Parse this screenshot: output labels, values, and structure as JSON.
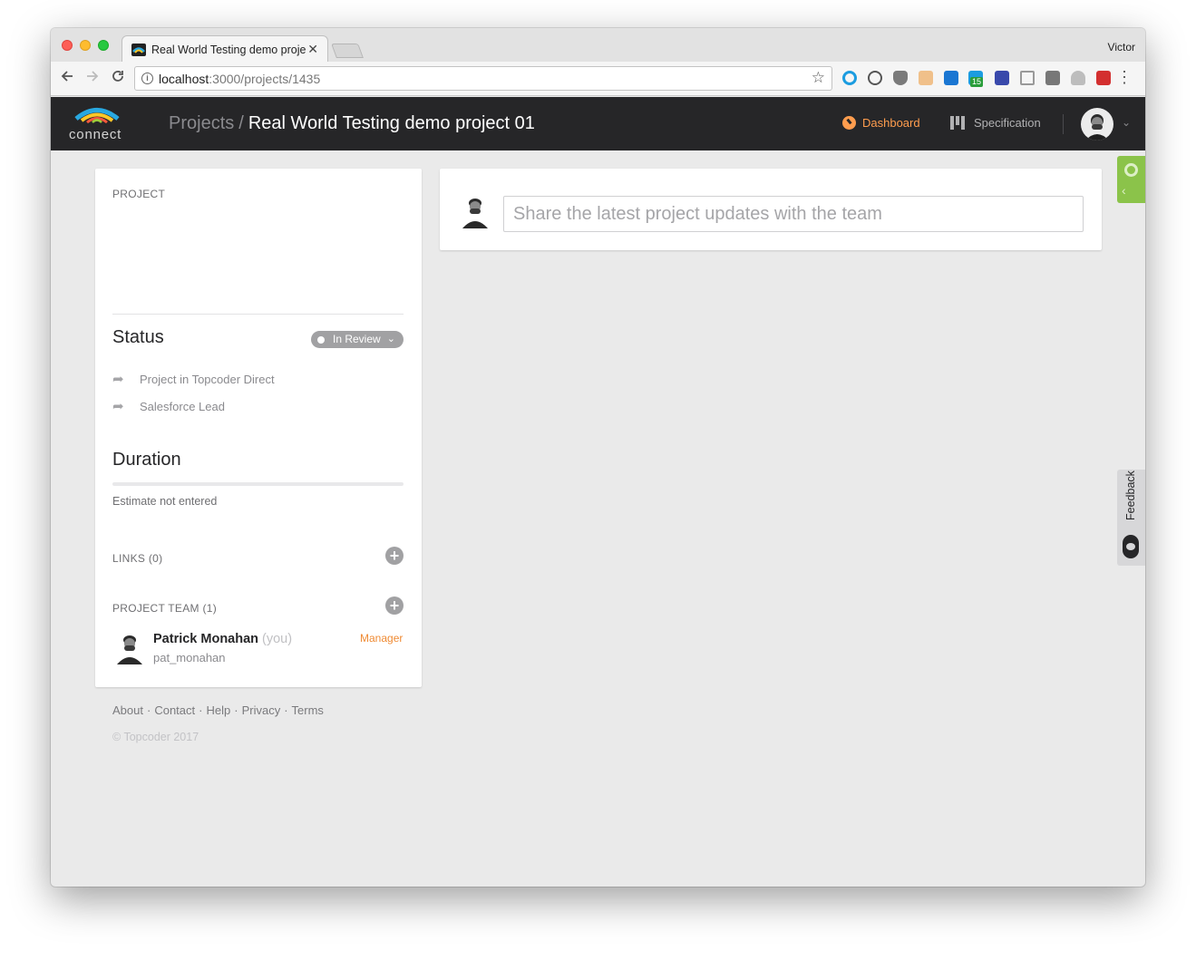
{
  "browser": {
    "tab_title": "Real World Testing demo project 01",
    "tab_close": "✕",
    "profile_name": "Victor",
    "url_host": "localhost",
    "url_path": ":3000/projects/1435",
    "extension_badge": "15"
  },
  "header": {
    "logo_text": "connect",
    "breadcrumb_root": "Projects",
    "breadcrumb_sep": "/",
    "project_title": "Real World Testing demo project 01",
    "nav_dashboard": "Dashboard",
    "nav_specification": "Specification"
  },
  "sidebar": {
    "project_label": "PROJECT",
    "status_heading": "Status",
    "status_value": "In Review",
    "links": [
      {
        "label": "Project in Topcoder Direct"
      },
      {
        "label": "Salesforce Lead"
      }
    ],
    "duration_heading": "Duration",
    "estimate_text": "Estimate not entered",
    "links_label": "LINKS (0)",
    "team_label": "PROJECT TEAM (1)",
    "member": {
      "name": "Patrick Monahan",
      "you": "(you)",
      "handle": "pat_monahan",
      "role": "Manager"
    }
  },
  "footer": {
    "links": [
      "About",
      "Contact",
      "Help",
      "Privacy",
      "Terms"
    ],
    "separator": "·",
    "copyright": "© Topcoder 2017"
  },
  "feed": {
    "placeholder": "Share the latest project updates with the team"
  },
  "widgets": {
    "feedback_label": "Feedback"
  },
  "colors": {
    "accent_orange": "#ff9d4e",
    "role_orange": "#ef8a33",
    "appbar_bg": "#262628",
    "page_bg": "#eaeaea",
    "widget_green": "#8bc34a"
  }
}
